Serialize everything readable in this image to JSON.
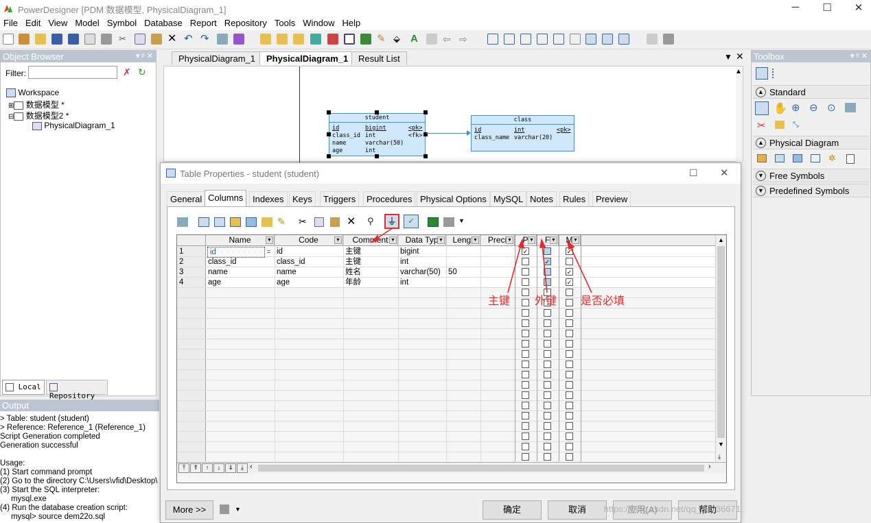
{
  "app": {
    "title": "PowerDesigner [PDM 数据模型, PhysicalDiagram_1]",
    "controls": {
      "minimize": "─",
      "maximize": "☐",
      "close": "✕"
    }
  },
  "menu": [
    "File",
    "Edit",
    "View",
    "Model",
    "Symbol",
    "Database",
    "Report",
    "Repository",
    "Tools",
    "Window",
    "Help"
  ],
  "object_browser": {
    "title": "Object Browser",
    "pin": "▾ ᵖ ✕",
    "filter_label": "Filter:",
    "filter_value": "",
    "tree": {
      "workspace": "Workspace",
      "model1": "数据模型 *",
      "model2": "数据模型2 *",
      "diagram": "PhysicalDiagram_1"
    },
    "tabs": {
      "local": "Local",
      "repository": "Repository"
    }
  },
  "diagram_tabs": {
    "tab1": "PhysicalDiagram_1",
    "tab2": "PhysicalDiagram_1",
    "tab3": "Result List"
  },
  "diagram": {
    "student": {
      "name": "student",
      "rows": [
        {
          "c": "id",
          "t": "bigint",
          "k": "<pk>"
        },
        {
          "c": "class_id",
          "t": "int",
          "k": "<fk>"
        },
        {
          "c": "name",
          "t": "varchar(50)",
          "k": ""
        },
        {
          "c": "age",
          "t": "int",
          "k": ""
        }
      ]
    },
    "class": {
      "name": "class",
      "rows": [
        {
          "c": "id",
          "t": "int",
          "k": "<pk>"
        },
        {
          "c": "class_name",
          "t": "varchar(20)",
          "k": ""
        }
      ]
    }
  },
  "toolbox": {
    "title": "Toolbox",
    "pin": "▾ ᵖ ✕",
    "sections": {
      "standard": "Standard",
      "physical": "Physical Diagram",
      "free": "Free Symbols",
      "predefined": "Predefined Symbols"
    }
  },
  "output": {
    "title": "Output",
    "lines": [
      "> Table: student (student)",
      "> Reference: Reference_1 (Reference_1)",
      "Script Generation completed",
      "Generation successful",
      "",
      "Usage:",
      " (1) Start command prompt",
      " (2) Go to the directory C:\\Users\\vfid\\Desktop\\",
      " (3) Start the SQL interpreter:",
      "     mysql.exe",
      " (4) Run the database creation script:",
      "     mysql> source dem22o.sql"
    ]
  },
  "dialog": {
    "title": "Table Properties - student (student)",
    "tabs": {
      "general": "General",
      "columns": "Columns",
      "indexes": "Indexes",
      "keys": "Keys",
      "triggers": "Triggers",
      "procedures": "Procedures",
      "physical": "Physical Options",
      "mysql": "MySQL",
      "notes": "Notes",
      "rules": "Rules",
      "preview": "Preview"
    },
    "grid": {
      "headers": {
        "name": "Name",
        "code": "Code",
        "comment": "Comment",
        "datatype": "Data Typ",
        "length": "Lengt",
        "precision": "Preci",
        "p": "P",
        "f": "F",
        "m": "M"
      },
      "rows": [
        {
          "n": "1",
          "name": "id",
          "code": "id",
          "comment": "主键",
          "type": "bigint",
          "len": "",
          "p": true,
          "f": false,
          "m": true
        },
        {
          "n": "2",
          "name": "class_id",
          "code": "class_id",
          "comment": "主键",
          "type": "int",
          "len": "",
          "p": false,
          "f": true,
          "m": false
        },
        {
          "n": "3",
          "name": "name",
          "code": "name",
          "comment": "姓名",
          "type": "varchar(50)",
          "len": "50",
          "p": false,
          "f": false,
          "m": true
        },
        {
          "n": "4",
          "name": "age",
          "code": "age",
          "comment": "年龄",
          "type": "int",
          "len": "",
          "p": false,
          "f": false,
          "m": true
        }
      ],
      "eq_marker": "="
    },
    "annotations": {
      "pk": "主键",
      "fk": "外键",
      "mandatory": "是否必填"
    },
    "buttons": {
      "more": "More >>",
      "ok": "确定",
      "cancel": "取消",
      "apply": "应用(A)",
      "help": "帮助"
    },
    "watermark": "https://blog.csdn.net/qq_39736671"
  }
}
